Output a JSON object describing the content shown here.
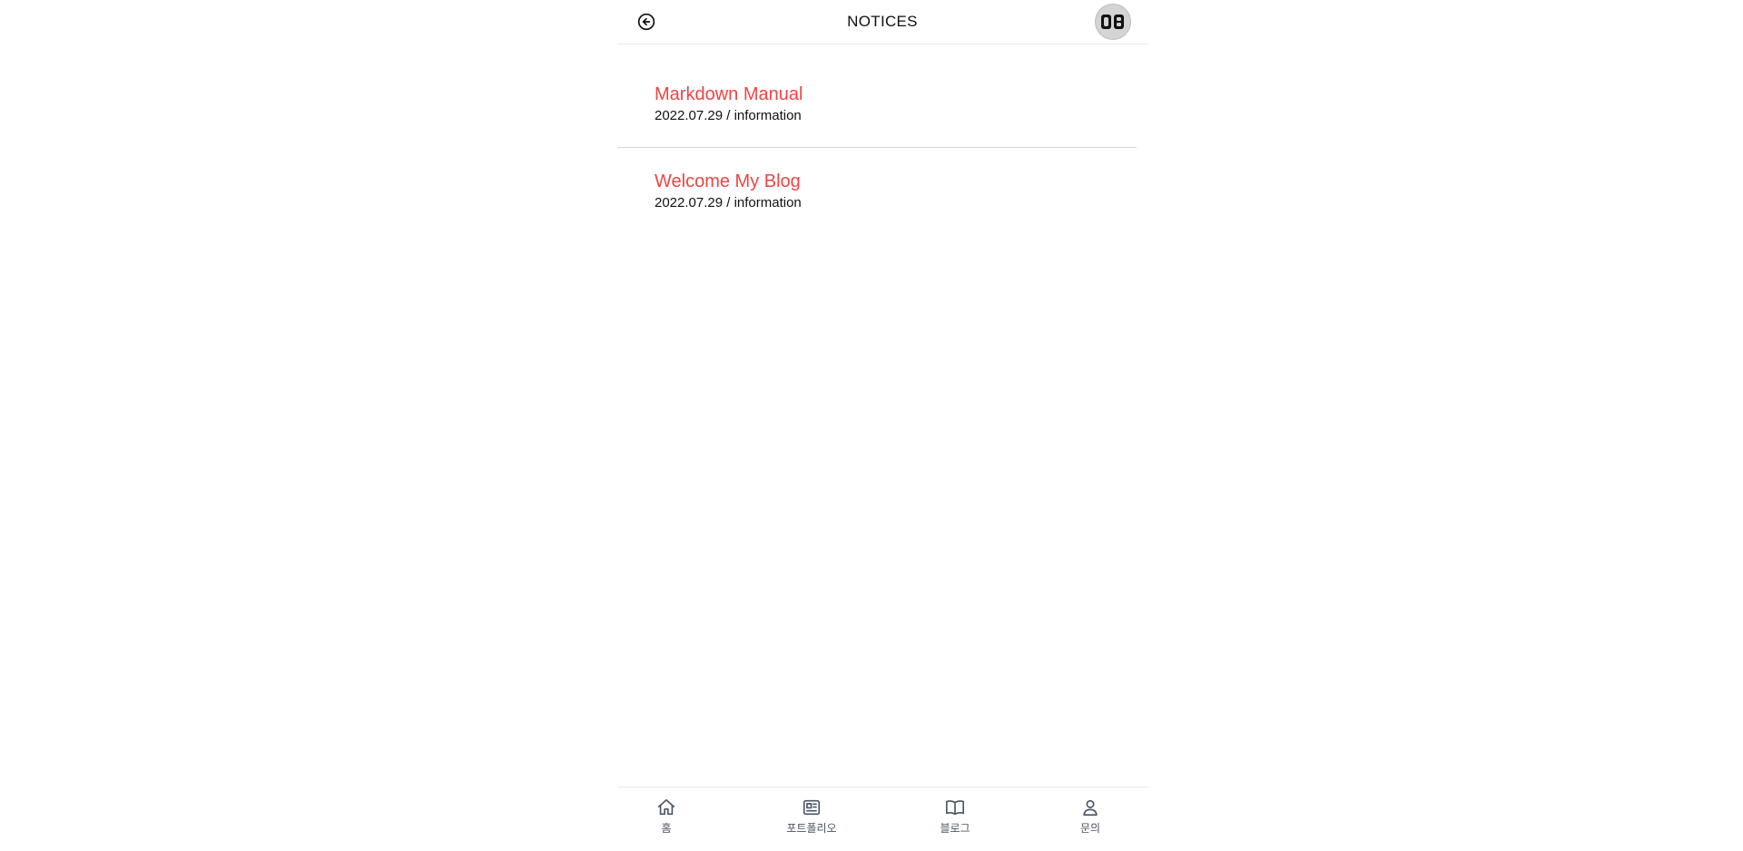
{
  "header": {
    "title": "NOTICES",
    "back_icon": "arrow-left-circle-icon",
    "avatar_icon": "avatar-logo"
  },
  "notices": [
    {
      "title": "Markdown Manual",
      "meta": "2022.07.29 / information"
    },
    {
      "title": "Welcome My Blog",
      "meta": "2022.07.29 / information"
    }
  ],
  "bottom_nav": {
    "items": [
      {
        "label": "홈",
        "icon": "home-icon"
      },
      {
        "label": "포트폴리오",
        "icon": "newspaper-icon"
      },
      {
        "label": "블로그",
        "icon": "book-open-icon"
      },
      {
        "label": "문의",
        "icon": "user-icon"
      }
    ]
  },
  "colors": {
    "accent": "#ef4444",
    "text": "#111111",
    "muted": "#4b5563",
    "divider": "#e5e7eb"
  }
}
